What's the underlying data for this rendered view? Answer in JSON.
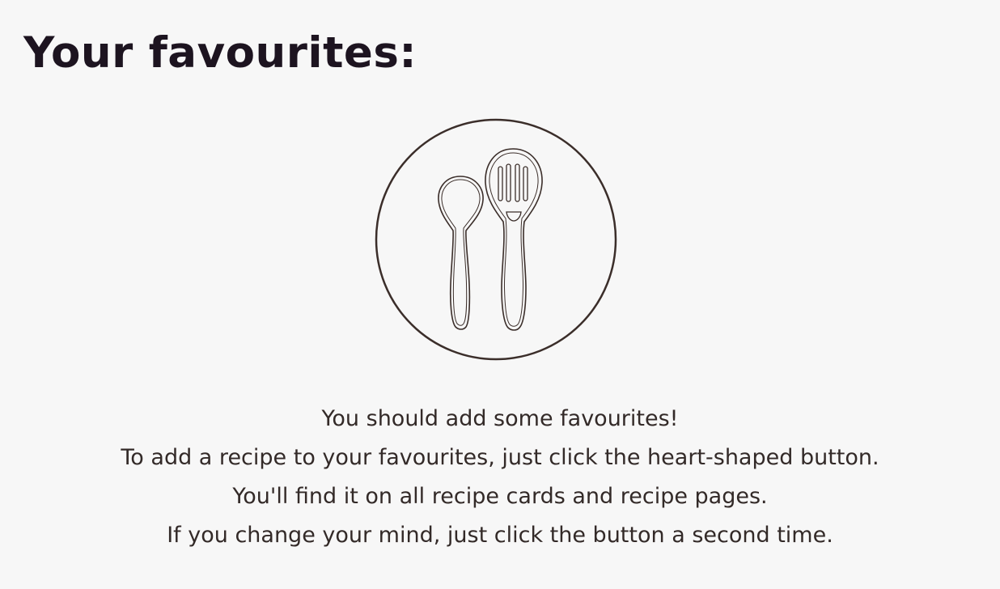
{
  "page": {
    "title": "Your favourites:"
  },
  "empty_state": {
    "illustration_icon": "spoon-and-slotted-spoon-icon",
    "lines": [
      "You should add some favourites!",
      "To add a recipe to your favourites, just click the heart-shaped button.",
      "You'll find it on all recipe cards and recipe pages.",
      "If you change your mind, just click the button a second time."
    ]
  },
  "colors": {
    "background": "#f7f7f7",
    "title": "#1d1420",
    "text": "#332a28",
    "icon_stroke": "#3b2e2a"
  }
}
